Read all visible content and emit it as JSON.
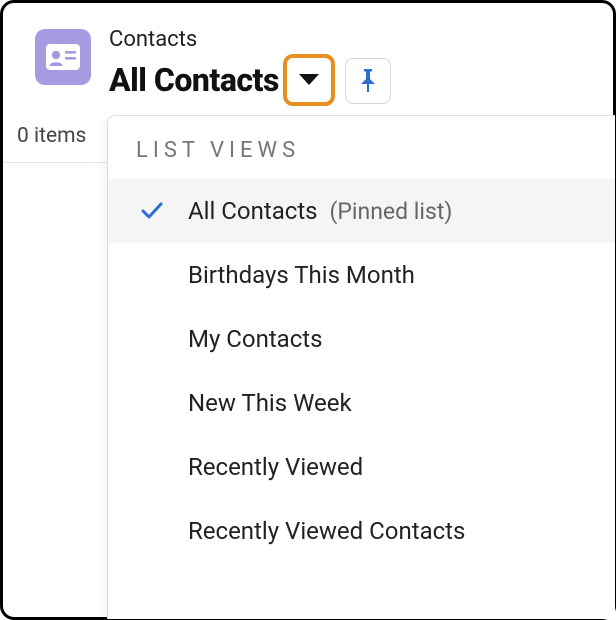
{
  "header": {
    "object_label": "Contacts",
    "view_title": "All Contacts",
    "icon_name": "contact-card-icon"
  },
  "meta": {
    "items_text": "0 items"
  },
  "dropdown": {
    "section_label": "LIST VIEWS",
    "options": [
      {
        "label": "All Contacts",
        "suffix": "(Pinned list)",
        "selected": true
      },
      {
        "label": "Birthdays This Month",
        "suffix": "",
        "selected": false
      },
      {
        "label": "My Contacts",
        "suffix": "",
        "selected": false
      },
      {
        "label": "New This Week",
        "suffix": "",
        "selected": false
      },
      {
        "label": "Recently Viewed",
        "suffix": "",
        "selected": false
      },
      {
        "label": "Recently Viewed Contacts",
        "suffix": "",
        "selected": false
      }
    ]
  },
  "colors": {
    "icon_bg": "#a79ae1",
    "highlight_border": "#e78e25",
    "pin_color": "#2d6fd1",
    "check_color": "#2d6fd1"
  }
}
